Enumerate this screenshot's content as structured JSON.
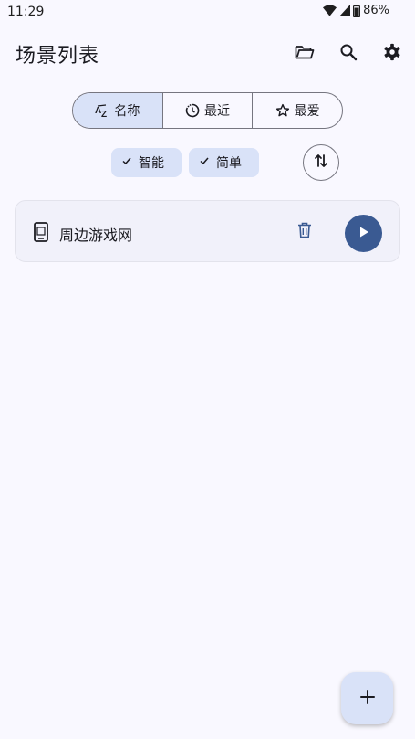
{
  "status_bar": {
    "time": "11:29",
    "battery": "86%",
    "icons": [
      "wifi-icon",
      "signal-icon",
      "battery-icon"
    ]
  },
  "header": {
    "title": "场景列表",
    "actions": [
      "folder-icon",
      "search-icon",
      "gear-icon"
    ]
  },
  "sort_tabs": [
    {
      "label": "名称",
      "icon": "sort-az-icon",
      "selected": true
    },
    {
      "label": "最近",
      "icon": "clock-icon",
      "selected": false
    },
    {
      "label": "最爱",
      "icon": "star-icon",
      "selected": false
    }
  ],
  "filters": [
    {
      "label": "智能",
      "checked": true
    },
    {
      "label": "简单",
      "checked": true
    }
  ],
  "scenes": [
    {
      "name": "周边游戏网",
      "icon": "phone-icon"
    }
  ],
  "fab": {
    "icon": "plus-icon"
  },
  "colors": {
    "background": "#f9f8ff",
    "accent": "#3a5a92",
    "selected": "#d9e2f8",
    "card": "#f1f1fa"
  }
}
